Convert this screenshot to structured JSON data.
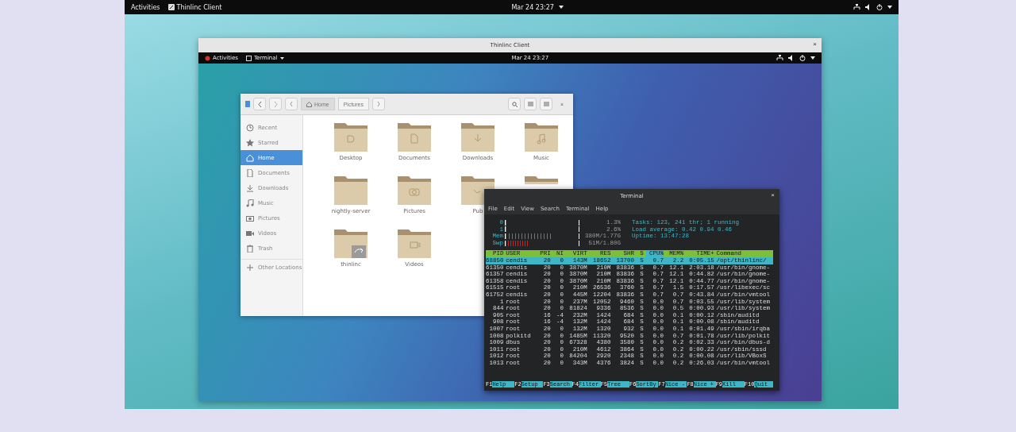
{
  "top_bar": {
    "activities": "Activities",
    "app": "Thinlinc Client",
    "clock": "Mar 24 23:27"
  },
  "client_window": {
    "title": "Thinlinc Client",
    "close": "×",
    "top_bar": {
      "activities": "Activities",
      "app": "Terminal",
      "clock": "Mar 24 23:27"
    }
  },
  "files": {
    "close": "×",
    "path": [
      {
        "label": "Home",
        "selected": true
      },
      {
        "label": "Pictures",
        "selected": false
      }
    ],
    "sidebar": [
      {
        "label": "Recent",
        "selected": false
      },
      {
        "label": "Starred",
        "selected": false
      },
      {
        "label": "Home",
        "selected": true
      },
      {
        "label": "Documents",
        "selected": false
      },
      {
        "label": "Downloads",
        "selected": false
      },
      {
        "label": "Music",
        "selected": false
      },
      {
        "label": "Pictures",
        "selected": false
      },
      {
        "label": "Videos",
        "selected": false
      },
      {
        "label": "Trash",
        "selected": false
      },
      {
        "label": "Other Locations",
        "selected": false
      }
    ],
    "folders": [
      {
        "label": "Desktop",
        "covered": false
      },
      {
        "label": "Documents",
        "covered": false
      },
      {
        "label": "Downloads",
        "covered": false
      },
      {
        "label": "Music",
        "covered": false
      },
      {
        "label": "nightly-server",
        "covered": false
      },
      {
        "label": "Pictures",
        "covered": false
      },
      {
        "label": "Pub",
        "covered": false
      },
      {
        "covered": true
      },
      {
        "label": "thinlinc",
        "covered": false
      },
      {
        "label": "Videos",
        "covered": false
      }
    ]
  },
  "terminal": {
    "title": "Terminal",
    "close": "×",
    "menu": [
      "File",
      "Edit",
      "View",
      "Search",
      "Terminal",
      "Help"
    ],
    "meters": [
      {
        "label": "0",
        "level": 0.03,
        "reading": "1.3%"
      },
      {
        "label": "1",
        "level": 0.04,
        "reading": "2.6%"
      },
      {
        "label": "Mem",
        "level": 0.62,
        "reading": "380M/1.77G"
      },
      {
        "label": "Swp",
        "level": 0.3,
        "reading": "51M/1.80G"
      }
    ],
    "summary": [
      "Tasks: 123, 241 thr; 1 running",
      "Load average: 0.42 0.94 0.46",
      "Uptime: 13:47:28"
    ],
    "columns": [
      {
        "label": "PID",
        "sorted": false
      },
      {
        "label": "USER",
        "sorted": false
      },
      {
        "label": "PRI",
        "sorted": false
      },
      {
        "label": "NI",
        "sorted": false
      },
      {
        "label": "VIRT",
        "sorted": false
      },
      {
        "label": "RES",
        "sorted": false
      },
      {
        "label": "SHR",
        "sorted": false
      },
      {
        "label": "S",
        "sorted": false
      },
      {
        "label": "CPU%",
        "sorted": true
      },
      {
        "label": "MEM%",
        "sorted": false
      },
      {
        "label": "TIME+",
        "sorted": false
      },
      {
        "label": "Command",
        "sorted": false
      }
    ],
    "rows": [
      {
        "selected": true,
        "cells": [
          "68850",
          "cendis",
          "20",
          "0",
          "143M",
          "18652",
          "13700",
          "S",
          "0.7",
          "2.2",
          "0:05.15",
          "/opt/thinlinc/"
        ]
      },
      {
        "selected": false,
        "cells": [
          "61350",
          "cendis",
          "20",
          "0",
          "3870M",
          "210M",
          "83836",
          "S",
          "0.7",
          "12.1",
          "2:03.18",
          "/usr/bin/gnome-"
        ]
      },
      {
        "selected": false,
        "cells": [
          "61357",
          "cendis",
          "20",
          "0",
          "3870M",
          "210M",
          "83836",
          "S",
          "0.7",
          "12.1",
          "0:44.82",
          "/usr/bin/gnome-"
        ]
      },
      {
        "selected": false,
        "cells": [
          "61358",
          "cendis",
          "20",
          "0",
          "3870M",
          "210M",
          "83836",
          "S",
          "0.7",
          "12.1",
          "0:44.77",
          "/usr/bin/gnome-"
        ]
      },
      {
        "selected": false,
        "cells": [
          "61515",
          "root",
          "20",
          "0",
          "210M",
          "26536",
          "3760",
          "S",
          "0.7",
          "1.5",
          "0:17.57",
          "/usr/libexec/sc"
        ]
      },
      {
        "selected": false,
        "cells": [
          "61752",
          "cendis",
          "20",
          "0",
          "445M",
          "12204",
          "83836",
          "S",
          "0.7",
          "0.7",
          "0:43.84",
          "/usr/bin/vmtool"
        ]
      },
      {
        "selected": false,
        "cells": [
          "1",
          "root",
          "20",
          "0",
          "237M",
          "12052",
          "9460",
          "S",
          "0.0",
          "0.7",
          "0:03.55",
          "/usr/lib/system"
        ]
      },
      {
        "selected": false,
        "cells": [
          "844",
          "root",
          "20",
          "0",
          "81824",
          "9336",
          "8536",
          "S",
          "0.0",
          "0.5",
          "0:00.93",
          "/usr/lib/system"
        ]
      },
      {
        "selected": false,
        "cells": [
          "905",
          "root",
          "16",
          "-4",
          "232M",
          "1424",
          "684",
          "S",
          "0.0",
          "0.1",
          "0:00.12",
          "/sbin/auditd"
        ]
      },
      {
        "selected": false,
        "cells": [
          "908",
          "root",
          "16",
          "-4",
          "132M",
          "1424",
          "684",
          "S",
          "0.0",
          "0.1",
          "0:00.08",
          "/sbin/auditd"
        ]
      },
      {
        "selected": false,
        "cells": [
          "1007",
          "root",
          "20",
          "0",
          "132M",
          "1320",
          "932",
          "S",
          "0.0",
          "0.1",
          "0:01.49",
          "/usr/sbin/irqba"
        ]
      },
      {
        "selected": false,
        "cells": [
          "1008",
          "polkitd",
          "20",
          "0",
          "1485M",
          "11320",
          "9520",
          "S",
          "0.0",
          "0.7",
          "0:01.78",
          "/usr/lib/polkit"
        ]
      },
      {
        "selected": false,
        "cells": [
          "1009",
          "dbus",
          "20",
          "0",
          "67328",
          "4380",
          "3580",
          "S",
          "0.0",
          "0.2",
          "0:02.33",
          "/usr/bin/dbus-d"
        ]
      },
      {
        "selected": false,
        "cells": [
          "1011",
          "root",
          "20",
          "0",
          "210M",
          "4612",
          "3864",
          "S",
          "0.0",
          "0.2",
          "0:00.22",
          "/usr/sbin/sssd"
        ]
      },
      {
        "selected": false,
        "cells": [
          "1012",
          "root",
          "20",
          "0",
          "84204",
          "2920",
          "2348",
          "S",
          "0.0",
          "0.2",
          "0:00.08",
          "/usr/lib/VBoxS"
        ]
      },
      {
        "selected": false,
        "cells": [
          "1013",
          "root",
          "20",
          "0",
          "343M",
          "4376",
          "3824",
          "S",
          "0.0",
          "0.2",
          "0:26.03",
          "/usr/bin/vmtool"
        ]
      }
    ],
    "function_keys": [
      {
        "key": "F1",
        "label": "Help"
      },
      {
        "key": "F2",
        "label": "Setup"
      },
      {
        "key": "F3",
        "label": "Search"
      },
      {
        "key": "F4",
        "label": "Filter"
      },
      {
        "key": "F5",
        "label": "Tree"
      },
      {
        "key": "F6",
        "label": "SortBy"
      },
      {
        "key": "F7",
        "label": "Nice -"
      },
      {
        "key": "F8",
        "label": "Nice +"
      },
      {
        "key": "F9",
        "label": "Kill"
      },
      {
        "key": "F10",
        "label": "Quit"
      }
    ]
  }
}
